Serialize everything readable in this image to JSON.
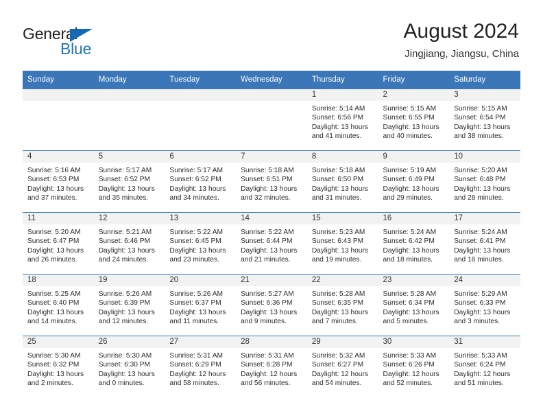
{
  "logo": {
    "word_general": "General",
    "word_blue": "Blue",
    "triangle_color": "#1369b5",
    "blue_text_color": "#1f72bd"
  },
  "header": {
    "title": "August 2024",
    "subtitle": "Jingjiang, Jiangsu, China"
  },
  "theme": {
    "header_blue": "#3a76b8",
    "daynum_band": "#f2f2f2",
    "text": "#222222"
  },
  "calendar": {
    "weekday_headers": [
      "Sunday",
      "Monday",
      "Tuesday",
      "Wednesday",
      "Thursday",
      "Friday",
      "Saturday"
    ],
    "weeks": [
      [
        {
          "day": "",
          "empty": true
        },
        {
          "day": "",
          "empty": true
        },
        {
          "day": "",
          "empty": true
        },
        {
          "day": "",
          "empty": true
        },
        {
          "day": "1",
          "sunrise": "Sunrise: 5:14 AM",
          "sunset": "Sunset: 6:56 PM",
          "daylight1": "Daylight: 13 hours",
          "daylight2": "and 41 minutes."
        },
        {
          "day": "2",
          "sunrise": "Sunrise: 5:15 AM",
          "sunset": "Sunset: 6:55 PM",
          "daylight1": "Daylight: 13 hours",
          "daylight2": "and 40 minutes."
        },
        {
          "day": "3",
          "sunrise": "Sunrise: 5:15 AM",
          "sunset": "Sunset: 6:54 PM",
          "daylight1": "Daylight: 13 hours",
          "daylight2": "and 38 minutes."
        }
      ],
      [
        {
          "day": "4",
          "sunrise": "Sunrise: 5:16 AM",
          "sunset": "Sunset: 6:53 PM",
          "daylight1": "Daylight: 13 hours",
          "daylight2": "and 37 minutes."
        },
        {
          "day": "5",
          "sunrise": "Sunrise: 5:17 AM",
          "sunset": "Sunset: 6:52 PM",
          "daylight1": "Daylight: 13 hours",
          "daylight2": "and 35 minutes."
        },
        {
          "day": "6",
          "sunrise": "Sunrise: 5:17 AM",
          "sunset": "Sunset: 6:52 PM",
          "daylight1": "Daylight: 13 hours",
          "daylight2": "and 34 minutes."
        },
        {
          "day": "7",
          "sunrise": "Sunrise: 5:18 AM",
          "sunset": "Sunset: 6:51 PM",
          "daylight1": "Daylight: 13 hours",
          "daylight2": "and 32 minutes."
        },
        {
          "day": "8",
          "sunrise": "Sunrise: 5:18 AM",
          "sunset": "Sunset: 6:50 PM",
          "daylight1": "Daylight: 13 hours",
          "daylight2": "and 31 minutes."
        },
        {
          "day": "9",
          "sunrise": "Sunrise: 5:19 AM",
          "sunset": "Sunset: 6:49 PM",
          "daylight1": "Daylight: 13 hours",
          "daylight2": "and 29 minutes."
        },
        {
          "day": "10",
          "sunrise": "Sunrise: 5:20 AM",
          "sunset": "Sunset: 6:48 PM",
          "daylight1": "Daylight: 13 hours",
          "daylight2": "and 28 minutes."
        }
      ],
      [
        {
          "day": "11",
          "sunrise": "Sunrise: 5:20 AM",
          "sunset": "Sunset: 6:47 PM",
          "daylight1": "Daylight: 13 hours",
          "daylight2": "and 26 minutes."
        },
        {
          "day": "12",
          "sunrise": "Sunrise: 5:21 AM",
          "sunset": "Sunset: 6:46 PM",
          "daylight1": "Daylight: 13 hours",
          "daylight2": "and 24 minutes."
        },
        {
          "day": "13",
          "sunrise": "Sunrise: 5:22 AM",
          "sunset": "Sunset: 6:45 PM",
          "daylight1": "Daylight: 13 hours",
          "daylight2": "and 23 minutes."
        },
        {
          "day": "14",
          "sunrise": "Sunrise: 5:22 AM",
          "sunset": "Sunset: 6:44 PM",
          "daylight1": "Daylight: 13 hours",
          "daylight2": "and 21 minutes."
        },
        {
          "day": "15",
          "sunrise": "Sunrise: 5:23 AM",
          "sunset": "Sunset: 6:43 PM",
          "daylight1": "Daylight: 13 hours",
          "daylight2": "and 19 minutes."
        },
        {
          "day": "16",
          "sunrise": "Sunrise: 5:24 AM",
          "sunset": "Sunset: 6:42 PM",
          "daylight1": "Daylight: 13 hours",
          "daylight2": "and 18 minutes."
        },
        {
          "day": "17",
          "sunrise": "Sunrise: 5:24 AM",
          "sunset": "Sunset: 6:41 PM",
          "daylight1": "Daylight: 13 hours",
          "daylight2": "and 16 minutes."
        }
      ],
      [
        {
          "day": "18",
          "sunrise": "Sunrise: 5:25 AM",
          "sunset": "Sunset: 6:40 PM",
          "daylight1": "Daylight: 13 hours",
          "daylight2": "and 14 minutes."
        },
        {
          "day": "19",
          "sunrise": "Sunrise: 5:26 AM",
          "sunset": "Sunset: 6:39 PM",
          "daylight1": "Daylight: 13 hours",
          "daylight2": "and 12 minutes."
        },
        {
          "day": "20",
          "sunrise": "Sunrise: 5:26 AM",
          "sunset": "Sunset: 6:37 PM",
          "daylight1": "Daylight: 13 hours",
          "daylight2": "and 11 minutes."
        },
        {
          "day": "21",
          "sunrise": "Sunrise: 5:27 AM",
          "sunset": "Sunset: 6:36 PM",
          "daylight1": "Daylight: 13 hours",
          "daylight2": "and 9 minutes."
        },
        {
          "day": "22",
          "sunrise": "Sunrise: 5:28 AM",
          "sunset": "Sunset: 6:35 PM",
          "daylight1": "Daylight: 13 hours",
          "daylight2": "and 7 minutes."
        },
        {
          "day": "23",
          "sunrise": "Sunrise: 5:28 AM",
          "sunset": "Sunset: 6:34 PM",
          "daylight1": "Daylight: 13 hours",
          "daylight2": "and 5 minutes."
        },
        {
          "day": "24",
          "sunrise": "Sunrise: 5:29 AM",
          "sunset": "Sunset: 6:33 PM",
          "daylight1": "Daylight: 13 hours",
          "daylight2": "and 3 minutes."
        }
      ],
      [
        {
          "day": "25",
          "sunrise": "Sunrise: 5:30 AM",
          "sunset": "Sunset: 6:32 PM",
          "daylight1": "Daylight: 13 hours",
          "daylight2": "and 2 minutes."
        },
        {
          "day": "26",
          "sunrise": "Sunrise: 5:30 AM",
          "sunset": "Sunset: 6:30 PM",
          "daylight1": "Daylight: 13 hours",
          "daylight2": "and 0 minutes."
        },
        {
          "day": "27",
          "sunrise": "Sunrise: 5:31 AM",
          "sunset": "Sunset: 6:29 PM",
          "daylight1": "Daylight: 12 hours",
          "daylight2": "and 58 minutes."
        },
        {
          "day": "28",
          "sunrise": "Sunrise: 5:31 AM",
          "sunset": "Sunset: 6:28 PM",
          "daylight1": "Daylight: 12 hours",
          "daylight2": "and 56 minutes."
        },
        {
          "day": "29",
          "sunrise": "Sunrise: 5:32 AM",
          "sunset": "Sunset: 6:27 PM",
          "daylight1": "Daylight: 12 hours",
          "daylight2": "and 54 minutes."
        },
        {
          "day": "30",
          "sunrise": "Sunrise: 5:33 AM",
          "sunset": "Sunset: 6:26 PM",
          "daylight1": "Daylight: 12 hours",
          "daylight2": "and 52 minutes."
        },
        {
          "day": "31",
          "sunrise": "Sunrise: 5:33 AM",
          "sunset": "Sunset: 6:24 PM",
          "daylight1": "Daylight: 12 hours",
          "daylight2": "and 51 minutes."
        }
      ]
    ]
  }
}
